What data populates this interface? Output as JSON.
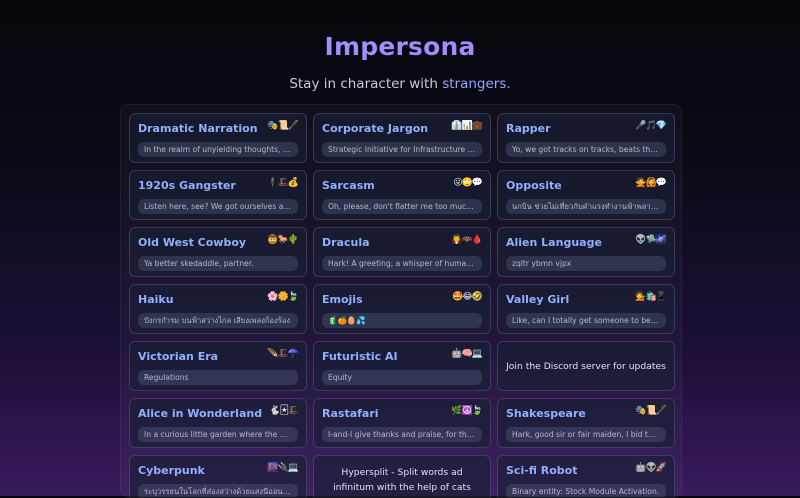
{
  "app": {
    "title": "Impersona",
    "subtitle_prefix": "Stay in character with ",
    "subtitle_accent": "strangers."
  },
  "cards": [
    {
      "id": "dramatic-narration",
      "title": "Dramatic Narration",
      "emoji": "🎭📜🖋️",
      "sample": "In the realm of unyielding thoughts, a fragil..."
    },
    {
      "id": "corporate-jargon",
      "title": "Corporate Jargon",
      "emoji": "👔📊💼",
      "sample": "Strategic Initiative for Infrastructure Advanc..."
    },
    {
      "id": "rapper",
      "title": "Rapper",
      "emoji": "🎤🎵💎",
      "sample": "Yo, we got tracks on tracks, beats that atta..."
    },
    {
      "id": "1920s-gangster",
      "title": "1920s Gangster",
      "emoji": "🕴️🎩💰",
      "sample": "Listen here, see? We got ourselves a hot di..."
    },
    {
      "id": "sarcasm",
      "title": "Sarcasm",
      "emoji": "😜🙄💬",
      "sample": "Oh, please, don't flatter me too much! I'm ju..."
    },
    {
      "id": "opposite",
      "title": "Opposite",
      "emoji": "🙅🙆💬",
      "sample": "นกบิน ช่วยไม่เที่ยวกับคำแรงทำงานฟ้าพลานให้กับเอ็..."
    },
    {
      "id": "old-west-cowboy",
      "title": "Old West Cowboy",
      "emoji": "🤠🐎🌵",
      "sample": "Ya better skedaddle, partner."
    },
    {
      "id": "dracula",
      "title": "Dracula",
      "emoji": "🧛🦇🩸",
      "sample": "Hark! A greeting, a whisper of human conn..."
    },
    {
      "id": "alien-language",
      "title": "Alien Language",
      "emoji": "👽🛸🌌",
      "sample": "zqltr ybmn vjpx"
    },
    {
      "id": "haiku",
      "title": "Haiku",
      "emoji": "🌸🌼🍃",
      "sample": "ปังกรกำรม บนฟ้าสว่างไกล เสียงเพลงก้องร้อง"
    },
    {
      "id": "emojis",
      "title": "Emojis",
      "emoji": "🤩😂🤣",
      "sample": "🧃🍊🥚💦"
    },
    {
      "id": "valley-girl",
      "title": "Valley Girl",
      "emoji": "💁🛍️📱",
      "sample": "Like, can I totally get someone to be my dol..."
    },
    {
      "id": "victorian-era",
      "title": "Victorian Era",
      "emoji": "🪶🎩☂️",
      "sample": "Regulations"
    },
    {
      "id": "futuristic-ai",
      "title": "Futuristic AI",
      "emoji": "🤖🧠💻",
      "sample": "Equity"
    },
    {
      "id": "discord",
      "info": "Join the Discord server for updates"
    },
    {
      "id": "alice-in-wonderland",
      "title": "Alice in Wonderland",
      "emoji": "🐇🃏🎩",
      "sample": "In a curious little garden where the flowers ..."
    },
    {
      "id": "rastafari",
      "title": "Rastafari",
      "emoji": "🌿☮️🍃",
      "sample": "I-and-I give thanks and praise, for the wisd..."
    },
    {
      "id": "shakespeare",
      "title": "Shakespeare",
      "emoji": "🎭📜🖋️",
      "sample": "Hark, good sir or fair maiden, I bid thee a gr..."
    },
    {
      "id": "cyberpunk",
      "title": "Cyberpunk",
      "emoji": "🌆🔌💻",
      "sample": "ระบุวรรธนในโลกที่ส่องสว่างด้วยแสงนีออนและเสียงอ..."
    },
    {
      "id": "hypersplit",
      "info": "Hypersplit - Split words ad infinitum with the help of cats"
    },
    {
      "id": "sci-fi-robot",
      "title": "Sci-fi Robot",
      "emoji": "🤖👽🚀",
      "sample": "Binary entity: Stock Module Activation."
    }
  ]
}
